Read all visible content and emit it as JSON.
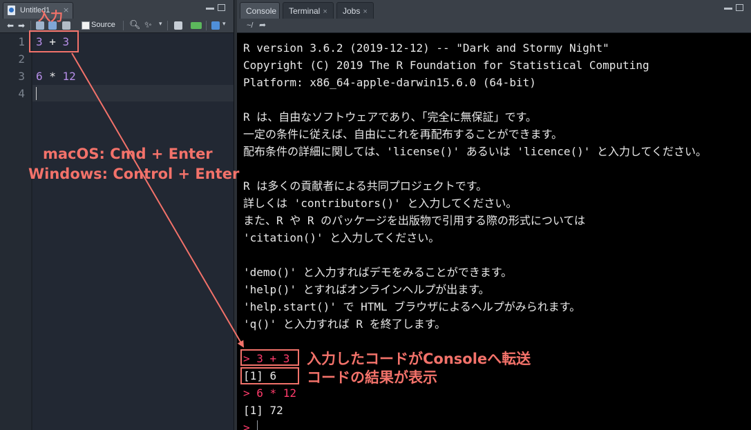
{
  "editor": {
    "tab_label": "Untitled1",
    "tab_close": "×",
    "toolbar_source_label": "Source",
    "lines": [
      {
        "no": "1",
        "code": [
          {
            "t": "3",
            "num": true
          },
          {
            "t": " + ",
            "num": false
          },
          {
            "t": "3",
            "num": true
          }
        ]
      },
      {
        "no": "2",
        "code": []
      },
      {
        "no": "3",
        "code": [
          {
            "t": "6",
            "num": true
          },
          {
            "t": " * ",
            "num": false
          },
          {
            "t": "12",
            "num": true
          }
        ]
      },
      {
        "no": "4",
        "code": []
      }
    ]
  },
  "console": {
    "tabs": [
      {
        "label": "Console",
        "closable": false
      },
      {
        "label": "Terminal",
        "closable": true
      },
      {
        "label": "Jobs",
        "closable": true
      }
    ],
    "tab_close": "×",
    "path": "~/",
    "lines": [
      {
        "text": "R version 3.6.2 (2019-12-12) -- \"Dark and Stormy Night\"",
        "prompt": false
      },
      {
        "text": "Copyright (C) 2019 The R Foundation for Statistical Computing",
        "prompt": false
      },
      {
        "text": "Platform: x86_64-apple-darwin15.6.0 (64-bit)",
        "prompt": false
      },
      {
        "text": "",
        "prompt": false
      },
      {
        "text": "R は、自由なソフトウェアであり、「完全に無保証」です。",
        "prompt": false
      },
      {
        "text": "一定の条件に従えば、自由にこれを再配布することができます。",
        "prompt": false
      },
      {
        "text": "配布条件の詳細に関しては、'license()' あるいは 'licence()' と入力してください。",
        "prompt": false
      },
      {
        "text": "",
        "prompt": false
      },
      {
        "text": "R は多くの貢献者による共同プロジェクトです。",
        "prompt": false
      },
      {
        "text": "詳しくは 'contributors()' と入力してください。",
        "prompt": false
      },
      {
        "text": "また、R や R のパッケージを出版物で引用する際の形式については",
        "prompt": false
      },
      {
        "text": "'citation()' と入力してください。",
        "prompt": false
      },
      {
        "text": "",
        "prompt": false
      },
      {
        "text": "'demo()' と入力すればデモをみることができます。",
        "prompt": false
      },
      {
        "text": "'help()' とすればオンラインヘルプが出ます。",
        "prompt": false
      },
      {
        "text": "'help.start()' で HTML ブラウザによるヘルプがみられます。",
        "prompt": false
      },
      {
        "text": "'q()' と入力すれば R を終了します。",
        "prompt": false
      },
      {
        "text": "",
        "prompt": false
      },
      {
        "text": "> 3 + 3",
        "prompt": true
      },
      {
        "text": "[1] 6",
        "prompt": false
      },
      {
        "text": "> 6 * 12",
        "prompt": true
      },
      {
        "text": "[1] 72",
        "prompt": false
      },
      {
        "text": ">",
        "prompt": true,
        "cursor": true
      }
    ]
  },
  "annotations": {
    "input_label": "入力",
    "shortcut_mac": "macOS: Cmd + Enter",
    "shortcut_win": "Windows: Control + Enter",
    "transfer_note": "入力したコードがConsoleへ転送",
    "result_note": "コードの結果が表示"
  },
  "colors": {
    "annotation": "#f3726a",
    "prompt": "#ff3b6b",
    "number": "#b68ee8"
  }
}
